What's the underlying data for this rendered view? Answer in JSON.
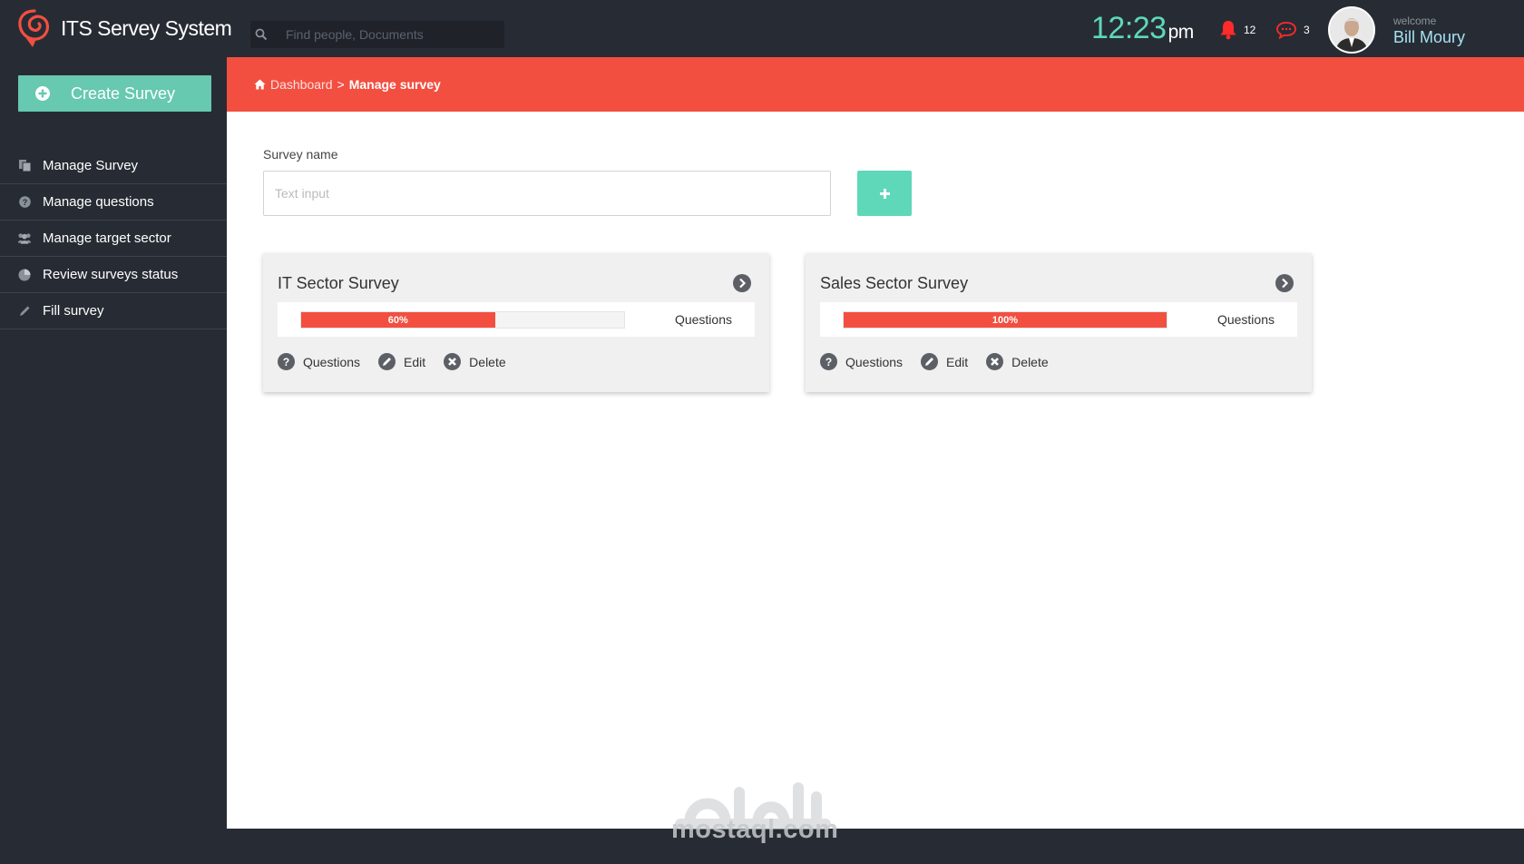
{
  "app": {
    "name": "ITS Servey System"
  },
  "search": {
    "placeholder": "Find people, Documents"
  },
  "clock": {
    "time": "12:23",
    "ampm": "pm"
  },
  "notifications": {
    "alerts_count": "12",
    "messages_count": "3",
    "alert_color": "#ff2a2a"
  },
  "user": {
    "welcome_label": "welcome",
    "name": "Bill Moury"
  },
  "sidebar": {
    "create_label": "Create Survey",
    "items": [
      {
        "label": "Manage Survey",
        "icon": "documents-icon"
      },
      {
        "label": "Manage questions",
        "icon": "question-circle-icon"
      },
      {
        "label": "Manage target sector",
        "icon": "users-icon"
      },
      {
        "label": "Review surveys status",
        "icon": "pie-chart-icon"
      },
      {
        "label": "Fill survey",
        "icon": "pencil-icon"
      }
    ]
  },
  "breadcrumb": {
    "home": "Dashboard",
    "separator": ">",
    "current": "Manage survey"
  },
  "form": {
    "label": "Survey name",
    "placeholder": "Text input"
  },
  "surveys": [
    {
      "title": "IT Sector Survey",
      "progress": 60,
      "progress_label": "60%",
      "progress_caption": "Questions",
      "actions": {
        "questions": "Questions",
        "edit": "Edit",
        "delete": "Delete"
      }
    },
    {
      "title": "Sales Sector Survey",
      "progress": 100,
      "progress_label": "100%",
      "progress_caption": "Questions",
      "actions": {
        "questions": "Questions",
        "edit": "Edit",
        "delete": "Delete"
      }
    }
  ],
  "watermark": {
    "latin": "mostaql.com"
  },
  "colors": {
    "accent": "#f24f41",
    "teal": "#5ed8b9",
    "create_button": "#66c9b0",
    "sidebar": "#272c34"
  }
}
